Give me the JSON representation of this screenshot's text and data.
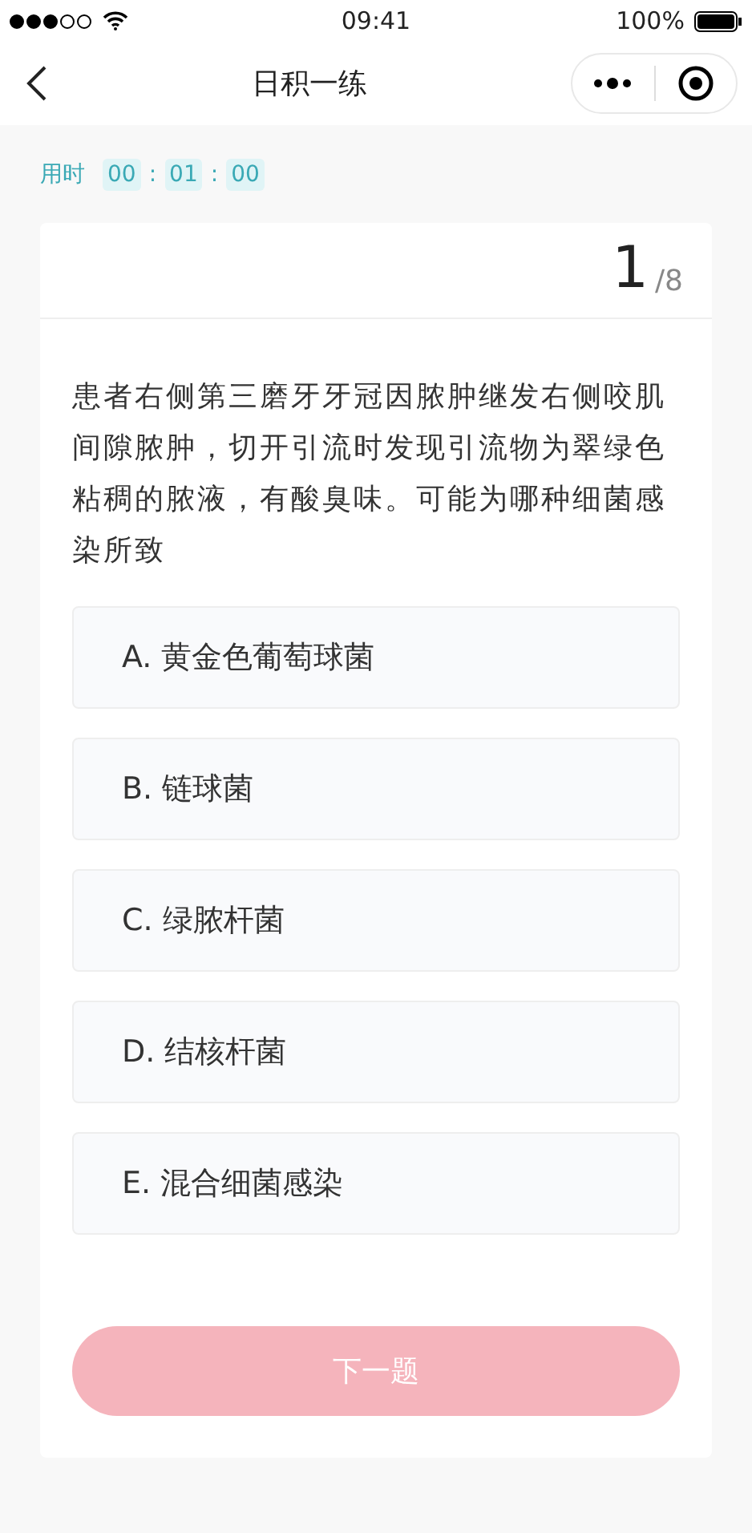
{
  "status_bar": {
    "time": "09:41",
    "battery": "100%"
  },
  "nav": {
    "title": "日积一练"
  },
  "timer": {
    "label": "用时",
    "parts": [
      "00",
      "01",
      "00"
    ],
    "separator": ":"
  },
  "card": {
    "current": "1",
    "total": "/8",
    "question": "患者右侧第三磨牙牙冠因脓肿继发右侧咬肌间隙脓肿，切开引流时发现引流物为翠绿色粘稠的脓液，有酸臭味。可能为哪种细菌感染所致",
    "options": [
      {
        "label": "A. 黄金色葡萄球菌",
        "selected": false
      },
      {
        "label": "B. 链球菌",
        "selected": false
      },
      {
        "label": "C. 绿脓杆菌",
        "selected": false
      },
      {
        "label": "D. 结核杆菌",
        "selected": false
      },
      {
        "label": "E. 混合细菌感染",
        "selected": false
      }
    ],
    "next_button": {
      "label": "下一题",
      "disabled": true
    }
  }
}
